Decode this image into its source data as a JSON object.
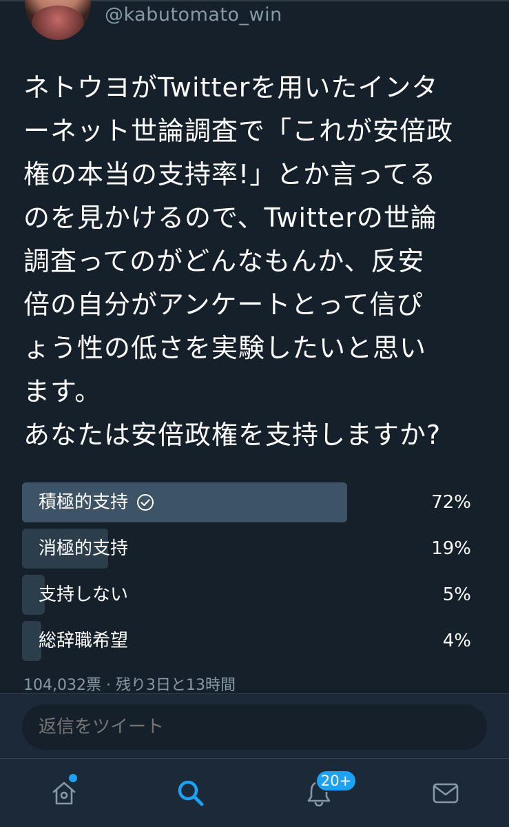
{
  "tweet": {
    "handle": "@kabutomato_win",
    "text": "ネトウヨがTwitterを用いたインタ\nーネット世論調査で「これが安倍政\n権の本当の支持率!」とか言ってる\nのを見かけるので、Twitterの世論\n調査ってのがどんなもんか、反安\n倍の自分がアンケートとって信ぴ\nょう性の低さを実験したいと思い\nます。\nあなたは安倍政権を支持しますか?"
  },
  "poll": {
    "options": [
      {
        "label": "積極的支持",
        "percent_text": "72%",
        "value": 72,
        "winner": true
      },
      {
        "label": "消極的支持",
        "percent_text": "19%",
        "value": 19,
        "winner": false
      },
      {
        "label": "支持しない",
        "percent_text": "5%",
        "value": 5,
        "winner": false
      },
      {
        "label": "総辞職希望",
        "percent_text": "4%",
        "value": 4,
        "winner": false
      }
    ],
    "meta": "104,032票 · 残り3日と13時間"
  },
  "reply": {
    "placeholder": "返信をツイート"
  },
  "tabbar": {
    "notifications_badge": "20+",
    "items": [
      "home-icon",
      "search-icon",
      "notifications-icon",
      "messages-icon"
    ]
  },
  "colors": {
    "background": "#15202b",
    "bar_winner": "#3d5466",
    "bar_other": "#2c3d4c",
    "accent": "#1da1f2",
    "muted_text": "#8899a6"
  }
}
